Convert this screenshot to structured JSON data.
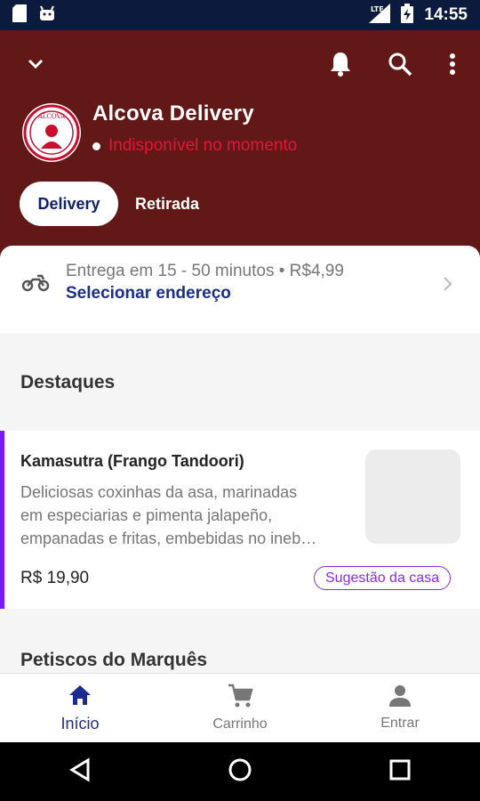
{
  "status_bar": {
    "time": "14:55",
    "network": "LTE",
    "icons": [
      "sd-card-icon",
      "android-icon",
      "signal-icon",
      "battery-charging-icon"
    ]
  },
  "header": {
    "store_name": "Alcova Delivery",
    "availability": "Indisponível no momento",
    "logo_text": "ALCOVA",
    "tabs": [
      {
        "label": "Delivery",
        "active": true
      },
      {
        "label": "Retirada",
        "active": false
      }
    ],
    "icons": [
      "chevron-down-icon",
      "bell-icon",
      "search-icon",
      "more-vert-icon"
    ]
  },
  "delivery": {
    "info": "Entrega em 15 - 50 minutos • R$4,99",
    "action": "Selecionar endereço"
  },
  "sections": {
    "highlights_title": "Destaques",
    "next_title": "Petiscos do Marquês"
  },
  "product": {
    "name": "Kamasutra (Frango Tandoori)",
    "description_lines": [
      "Deliciosas coxinhas da asa, marinadas",
      "em especiarias e pimenta jalapeño,",
      "empanadas e fritas, embebidas no ineb…"
    ],
    "price": "R$ 19,90",
    "badge": "Sugestão da casa"
  },
  "bottom_nav": [
    {
      "label": "Início",
      "icon": "home-icon",
      "active": true
    },
    {
      "label": "Carrinho",
      "icon": "cart-icon",
      "active": false
    },
    {
      "label": "Entrar",
      "icon": "person-icon",
      "active": false
    }
  ],
  "colors": {
    "header_bg": "#621817",
    "accent_purple": "#8a2cf0",
    "accent_blue": "#1d2b91",
    "unavailable_red": "#e3163a"
  }
}
